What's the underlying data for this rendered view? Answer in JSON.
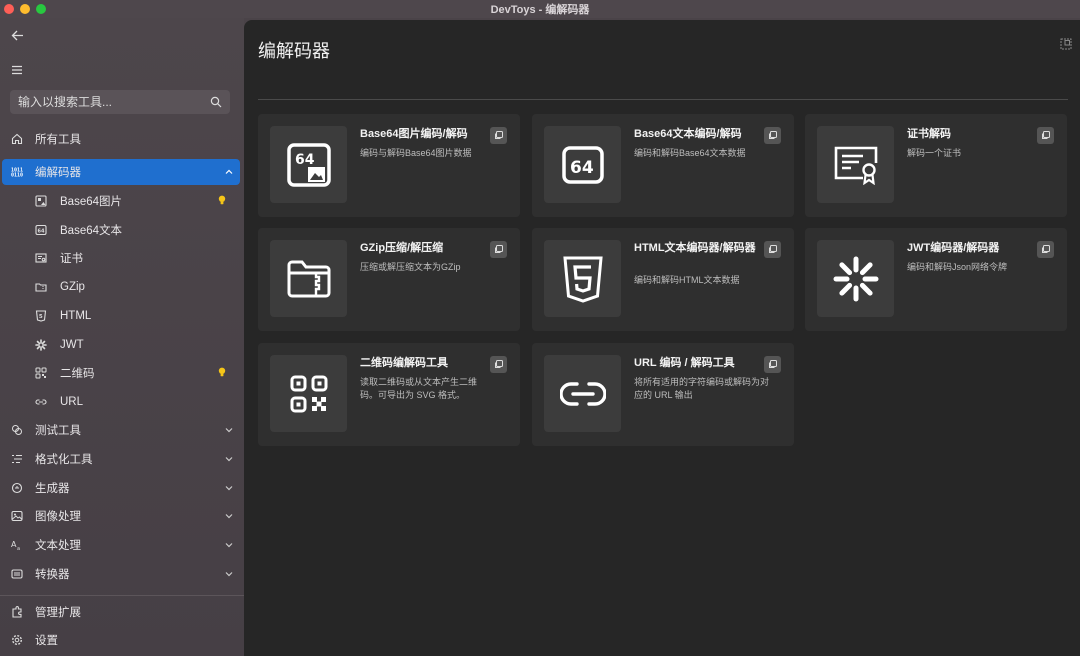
{
  "window": {
    "title": "DevToys - 编解码器"
  },
  "sidebar": {
    "search_placeholder": "输入以搜索工具...",
    "items": [
      {
        "label": "所有工具",
        "icon": "home-icon"
      },
      {
        "label": "编解码器",
        "icon": "binary-icon",
        "expanded": true
      },
      {
        "label": "Base64图片",
        "icon": "image-icon"
      },
      {
        "label": "Base64文本",
        "icon": "base64-icon"
      },
      {
        "label": "证书",
        "icon": "certificate-icon"
      },
      {
        "label": "GZip",
        "icon": "folder-zip-icon"
      },
      {
        "label": "HTML",
        "icon": "html5-icon"
      },
      {
        "label": "JWT",
        "icon": "jwt-icon"
      },
      {
        "label": "二维码",
        "icon": "qr-code-icon"
      },
      {
        "label": "URL",
        "icon": "link-icon"
      },
      {
        "label": "测试工具",
        "icon": "test-icon"
      },
      {
        "label": "格式化工具",
        "icon": "format-icon"
      },
      {
        "label": "生成器",
        "icon": "generator-icon"
      },
      {
        "label": "图像处理",
        "icon": "image-process-icon"
      },
      {
        "label": "文本处理",
        "icon": "text-icon"
      },
      {
        "label": "转换器",
        "icon": "converter-icon"
      },
      {
        "label": "管理扩展",
        "icon": "extension-icon"
      },
      {
        "label": "设置",
        "icon": "settings-icon"
      }
    ]
  },
  "main": {
    "title": "编解码器",
    "cards": [
      {
        "title": "Base64图片编码/解码",
        "desc": "编码与解码Base64图片数据",
        "icon": "base64-image-icon"
      },
      {
        "title": "Base64文本编码/解码",
        "desc": "编码和解码Base64文本数据",
        "icon": "base64-text-icon"
      },
      {
        "title": "证书解码",
        "desc": "解码一个证书",
        "icon": "certificate-icon"
      },
      {
        "title": "GZip压缩/解压缩",
        "desc": "压缩或解压缩文本为GZip",
        "icon": "folder-zip-icon"
      },
      {
        "title": "HTML文本编码器/解码器",
        "desc": "编码和解码HTML文本数据",
        "icon": "html5-icon"
      },
      {
        "title": "JWT编码器/解码器",
        "desc": "编码和解码Json网络令牌",
        "icon": "jwt-icon"
      },
      {
        "title": "二维码编解码工具",
        "desc": "读取二维码或从文本产生二维码。可导出为 SVG 格式。",
        "icon": "qr-code-icon"
      },
      {
        "title": "URL 编码 / 解码工具",
        "desc": "将所有适用的字符编码或解码为对应的 URL 输出",
        "icon": "link-icon"
      }
    ]
  },
  "colors": {
    "accent": "#1f6fcf",
    "bulb": "#f5c518"
  }
}
